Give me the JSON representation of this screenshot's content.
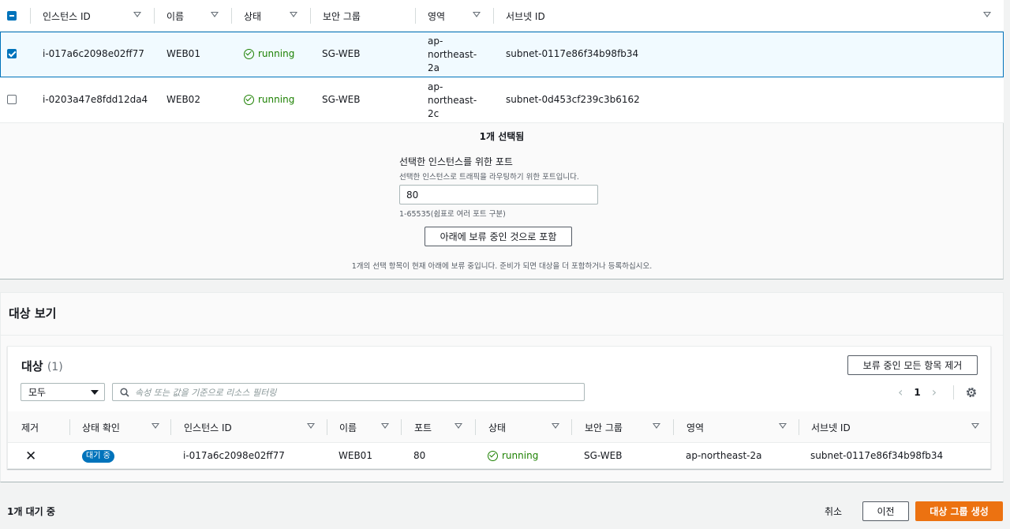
{
  "instances_table": {
    "columns": [
      "인스턴스 ID",
      "이름",
      "상태",
      "보안 그룹",
      "영역",
      "서브넷 ID"
    ],
    "rows": [
      {
        "checked": true,
        "instance_id": "i-017a6c2098e02ff77",
        "name": "WEB01",
        "status": "running",
        "security_group": "SG-WEB",
        "region_lines": [
          "ap-",
          "northeast-",
          "2a"
        ],
        "subnet": "subnet-0117e86f34b98fb34"
      },
      {
        "checked": false,
        "instance_id": "i-0203a47e8fdd12da4",
        "name": "WEB02",
        "status": "running",
        "security_group": "SG-WEB",
        "region_lines": [
          "ap-",
          "northeast-",
          "2c"
        ],
        "subnet": "subnet-0d453cf239c3b6162"
      }
    ]
  },
  "selection": {
    "count_text": "1개 선택됨",
    "port_title": "선택한 인스턴스를 위한 포트",
    "port_desc": "선택한 인스턴스로 트래픽을 라우팅하기 위한 포트입니다.",
    "port_value": "80",
    "port_hint": "1-65535(쉼표로 여러 포트 구분)",
    "include_button": "아래에 보류 중인 것으로 포함",
    "pending_note": "1개의 선택 항목이 현재 아래에 보류 중입니다. 준비가 되면 대상을 더 포함하거나 등록하십시오."
  },
  "targets_view": {
    "section_title": "대상 보기",
    "card_title": "대상",
    "card_count": "(1)",
    "remove_all_button": "보류 중인 모든 항목 제거",
    "filter_select": "모두",
    "search_placeholder": "속성 또는 값을 기준으로 리소스 필터링",
    "page_number": "1",
    "columns": [
      "제거",
      "상태 확인",
      "인스턴스 ID",
      "이름",
      "포트",
      "상태",
      "보안 그룹",
      "영역",
      "서브넷 ID"
    ],
    "row": {
      "health": "대기 중",
      "instance_id": "i-017a6c2098e02ff77",
      "name": "WEB01",
      "port": "80",
      "status": "running",
      "security_group": "SG-WEB",
      "region": "ap-northeast-2a",
      "subnet": "subnet-0117e86f34b98fb34"
    }
  },
  "footer": {
    "pending_count": "1개 대기 중",
    "cancel": "취소",
    "previous": "이전",
    "create": "대상 그룹 생성"
  },
  "colors": {
    "accent": "#0073bb",
    "primary_button": "#ec7211",
    "running": "#1d8102"
  }
}
